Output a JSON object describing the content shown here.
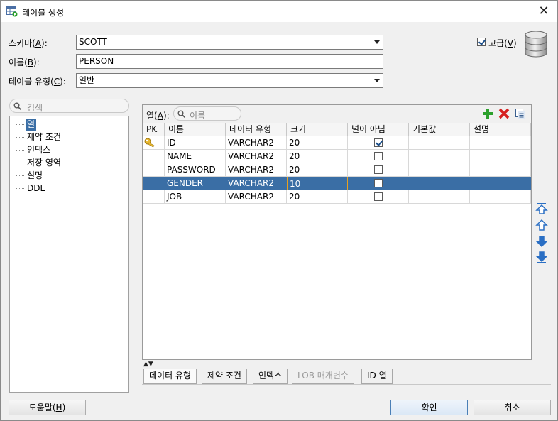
{
  "window": {
    "title": "테이블 생성"
  },
  "form": {
    "schema_label_pre": "스키마(",
    "schema_label_key": "A",
    "schema_label_post": "):",
    "schema_value": "SCOTT",
    "name_label_pre": "이름(",
    "name_label_key": "B",
    "name_label_post": "):",
    "name_value": "PERSON",
    "type_label_pre": "테이블 유형(",
    "type_label_key": "C",
    "type_label_post": "):",
    "type_value": "일반",
    "advanced_label_pre": "고급(",
    "advanced_label_key": "V",
    "advanced_label_post": ")",
    "advanced_checked": true
  },
  "left": {
    "search_placeholder": "검색",
    "tree": [
      "열",
      "제약 조건",
      "인덱스",
      "저장 영역",
      "설명",
      "DDL"
    ]
  },
  "columns_panel": {
    "label_pre": "열(",
    "label_key": "A",
    "label_post": "):",
    "search_placeholder": "이름",
    "headers": [
      "PK",
      "이름",
      "데이터 유형",
      "크기",
      "널이 아님",
      "기본값",
      "설명"
    ],
    "rows": [
      {
        "pk": true,
        "name": "ID",
        "type": "VARCHAR2",
        "size": "20",
        "not_null": true,
        "default": "",
        "comment": ""
      },
      {
        "pk": false,
        "name": "NAME",
        "type": "VARCHAR2",
        "size": "20",
        "not_null": false,
        "default": "",
        "comment": ""
      },
      {
        "pk": false,
        "name": "PASSWORD",
        "type": "VARCHAR2",
        "size": "20",
        "not_null": false,
        "default": "",
        "comment": ""
      },
      {
        "pk": false,
        "name": "GENDER",
        "type": "VARCHAR2",
        "size": "10",
        "not_null": false,
        "default": "",
        "comment": ""
      },
      {
        "pk": false,
        "name": "JOB",
        "type": "VARCHAR2",
        "size": "20",
        "not_null": false,
        "default": "",
        "comment": ""
      }
    ],
    "selected_row": 3
  },
  "bottom_tabs": [
    "데이터 유형",
    "제약 조건",
    "인덱스",
    "LOB 매개변수",
    "ID 열"
  ],
  "buttons": {
    "help_pre": "도움말(",
    "help_key": "H",
    "help_post": ")",
    "ok": "확인",
    "cancel": "취소"
  },
  "colors": {
    "selection": "#3a6ea5",
    "add": "#2ca02c",
    "delete": "#d62020",
    "move": "#2a6fc4"
  }
}
